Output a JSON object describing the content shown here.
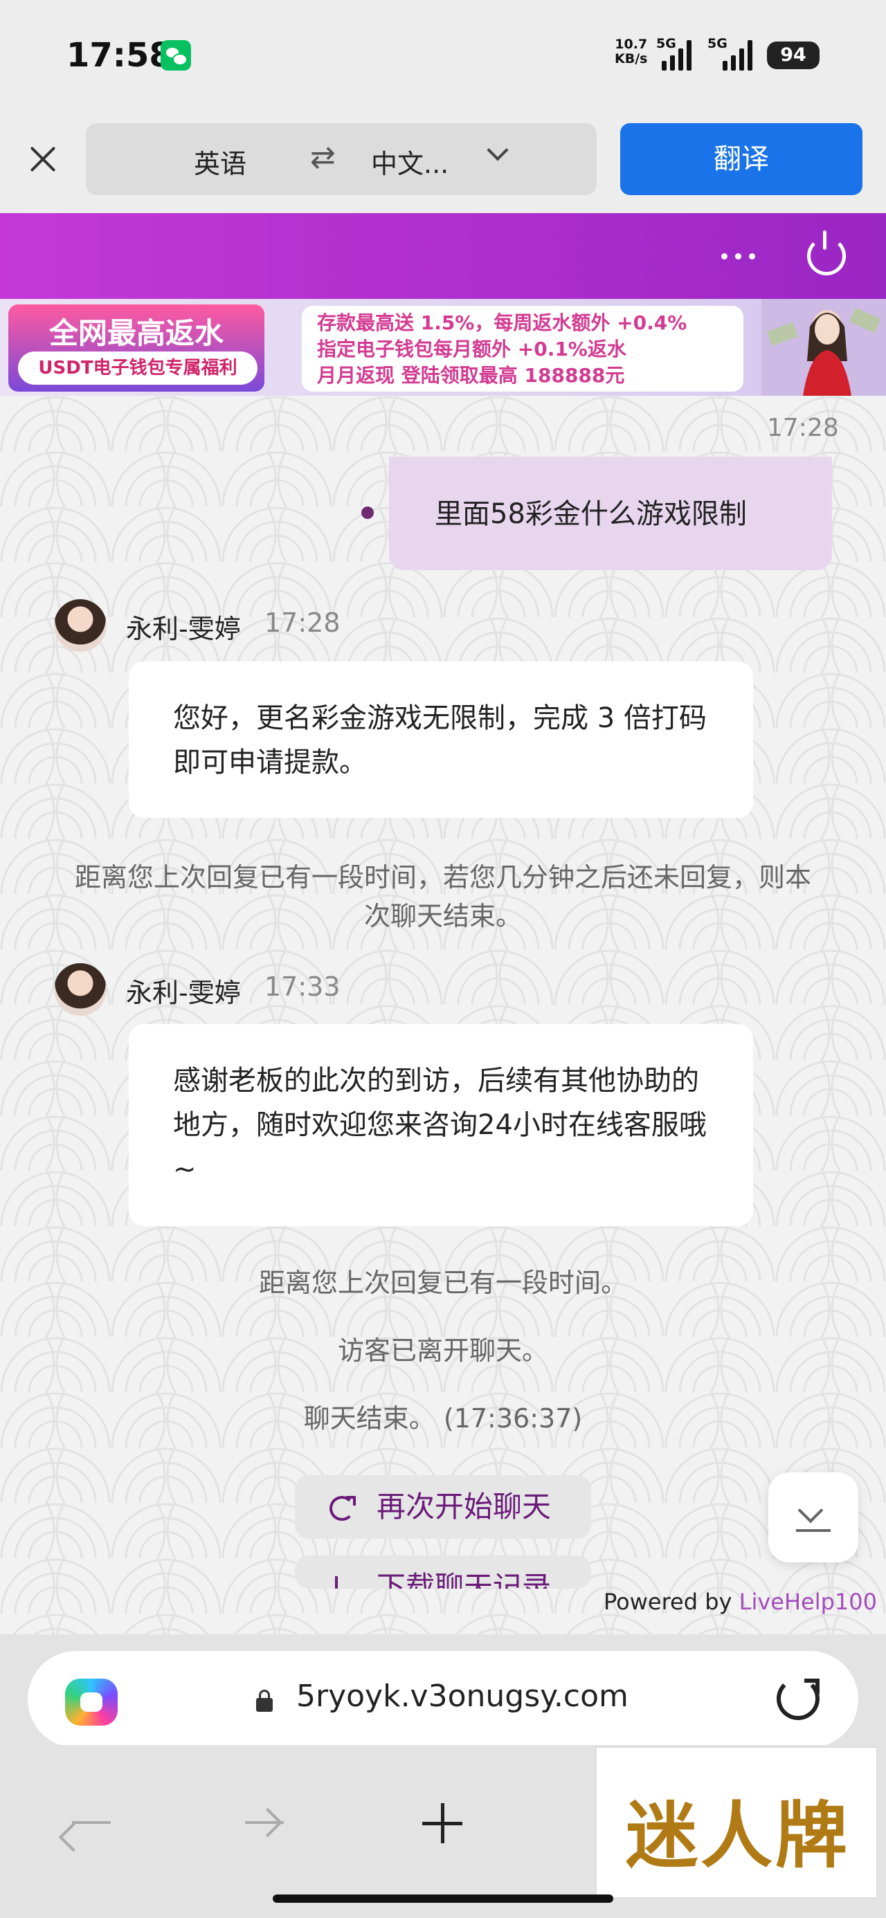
{
  "status_bar": {
    "time": "17:58",
    "net_speed": "10.7",
    "net_speed_unit": "KB/s",
    "network1": "5G",
    "network2": "5G",
    "battery": "94",
    "app_icon": "wechat-icon"
  },
  "translate_bar": {
    "source_lang": "英语",
    "target_lang": "中文...",
    "swap_symbol": "⇄",
    "translate_label": "翻译"
  },
  "banner": {
    "left_title": "全网最高返水",
    "left_subtitle": "USDT电子钱包专属福利",
    "line1": "存款最高送 1.5%，每周返水额外 +0.4%",
    "line2": "指定电子钱包每月额外 +0.1%返水",
    "line3": "月月返现 登陆领取最高 188888元"
  },
  "chat": {
    "visitor_time": "17:28",
    "visitor_message": "里面58彩金什么游戏限制",
    "agent_name": "永利-雯婷",
    "agent1_time": "17:28",
    "agent1_message": "您好，更名彩金游戏无限制，完成 3 倍打码 即可申请提款。",
    "system_warning": "距离您上次回复已有一段时间，若您几分钟之后还未回复，则本次聊天结束。",
    "agent2_time": "17:33",
    "agent2_message": "感谢老板的此次的到访，后续有其他协助的地方，随时欢迎您来咨询24小时在线客服哦~",
    "system_idle": "距离您上次回复已有一段时间。",
    "system_left": "访客已离开聊天。",
    "system_ended": "聊天结束。 (17:36:37)",
    "restart_label": "再次开始聊天",
    "download_label": "下载聊天记录",
    "powered_prefix": "Powered by ",
    "powered_brand": "LiveHelp100"
  },
  "browser": {
    "url": "5ryoyk.v3onugsy.com"
  },
  "watermark": "迷人牌",
  "colors": {
    "accent_blue": "#1a73e8",
    "header_purple": "#b52fd2",
    "visitor_bubble": "#e8d5ee",
    "link_purple": "#a34bbd"
  }
}
